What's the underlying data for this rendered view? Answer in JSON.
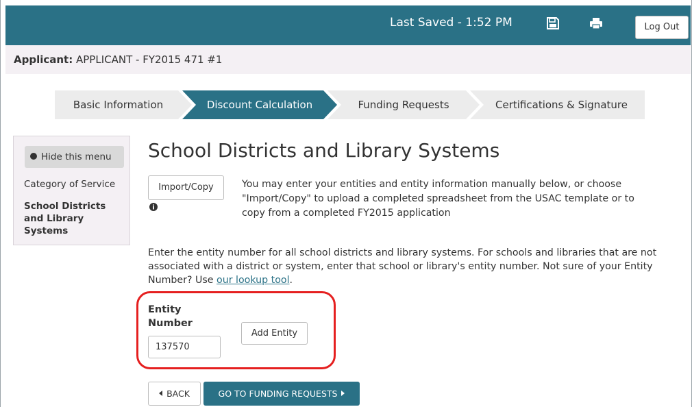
{
  "header": {
    "last_saved": "Last Saved - 1:52 PM",
    "save_icon": "floppy-disk-icon",
    "print_icon": "printer-icon",
    "logout_label": "Log Out",
    "bar_color": "#2a7186"
  },
  "applicant": {
    "label": "Applicant:",
    "value": " APPLICANT - FY2015 471 #1"
  },
  "steps": [
    {
      "label": "Basic Information",
      "state": "complete"
    },
    {
      "label": "Discount Calculation",
      "state": "active"
    },
    {
      "label": "Funding Requests",
      "state": "upcoming"
    },
    {
      "label": "Certifications & Signature",
      "state": "upcoming"
    }
  ],
  "sidebar": {
    "hide_label": "Hide this menu",
    "items": [
      {
        "label": "Category of Service",
        "active": false
      },
      {
        "label": "School Districts and Library Systems",
        "active": true
      }
    ]
  },
  "main": {
    "title": "School Districts and Library Systems",
    "import_label": "Import/Copy",
    "info_icon": "info-circle-icon",
    "intro": "You may enter your entities and entity information manually below, or choose \"Import/Copy\" to upload a completed spreadsheet from the USAC template or to copy from a completed FY2015 application",
    "para_before_link": "Enter the entity number for all school districts and library systems. For schools and libraries that are not associated with a district or system, enter that school or library's entity number. Not sure of your Entity Number? Use ",
    "lookup_link": "our lookup tool",
    "para_after_link": ".",
    "entity_label": "Entity Number",
    "entity_value": "137570",
    "add_entity_label": "Add Entity",
    "back_label": "BACK",
    "next_label": "GO TO FUNDING REQUESTS",
    "highlight_color": "#e51f1f"
  }
}
